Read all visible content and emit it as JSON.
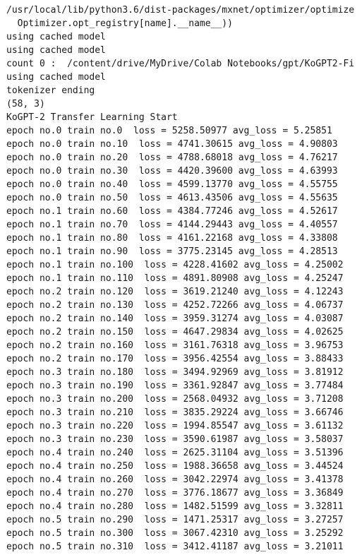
{
  "console": {
    "lines": [
      "/usr/local/lib/python3.6/dist-packages/mxnet/optimizer/optimize",
      "  Optimizer.opt_registry[name].__name__))",
      "using cached model",
      "using cached model",
      "count 0 :  /content/drive/MyDrive/Colab Notebooks/gpt/KoGPT2-Fi",
      "using cached model",
      "tokenizer ending",
      "(58, 3)",
      "KoGPT-2 Transfer Learning Start",
      "epoch no.0 train no.0  loss = 5258.50977 avg_loss = 5.25851",
      "epoch no.0 train no.10  loss = 4741.30615 avg_loss = 4.90803",
      "epoch no.0 train no.20  loss = 4788.68018 avg_loss = 4.76217",
      "epoch no.0 train no.30  loss = 4420.39600 avg_loss = 4.63993",
      "epoch no.0 train no.40  loss = 4599.13770 avg_loss = 4.55755",
      "epoch no.0 train no.50  loss = 4613.43506 avg_loss = 4.55635",
      "epoch no.1 train no.60  loss = 4384.77246 avg_loss = 4.52617",
      "epoch no.1 train no.70  loss = 4144.29443 avg_loss = 4.40557",
      "epoch no.1 train no.80  loss = 4161.22168 avg_loss = 4.33808",
      "epoch no.1 train no.90  loss = 3775.23145 avg_loss = 4.28513",
      "epoch no.1 train no.100  loss = 4228.41602 avg_loss = 4.25002",
      "epoch no.1 train no.110  loss = 4891.80908 avg_loss = 4.25247",
      "epoch no.2 train no.120  loss = 3619.21240 avg_loss = 4.12243",
      "epoch no.2 train no.130  loss = 4252.72266 avg_loss = 4.06737",
      "epoch no.2 train no.140  loss = 3959.31274 avg_loss = 4.03087",
      "epoch no.2 train no.150  loss = 4647.29834 avg_loss = 4.02625",
      "epoch no.2 train no.160  loss = 3161.76318 avg_loss = 3.96753",
      "epoch no.2 train no.170  loss = 3956.42554 avg_loss = 3.88433",
      "epoch no.3 train no.180  loss = 3494.92969 avg_loss = 3.81912",
      "epoch no.3 train no.190  loss = 3361.92847 avg_loss = 3.77484",
      "epoch no.3 train no.200  loss = 2568.04932 avg_loss = 3.71208",
      "epoch no.3 train no.210  loss = 3835.29224 avg_loss = 3.66746",
      "epoch no.3 train no.220  loss = 1994.85547 avg_loss = 3.61132",
      "epoch no.3 train no.230  loss = 3590.61987 avg_loss = 3.58037",
      "epoch no.4 train no.240  loss = 2625.31104 avg_loss = 3.51396",
      "epoch no.4 train no.250  loss = 1988.36658 avg_loss = 3.44524",
      "epoch no.4 train no.260  loss = 3042.22974 avg_loss = 3.41378",
      "epoch no.4 train no.270  loss = 3776.18677 avg_loss = 3.36849",
      "epoch no.4 train no.280  loss = 1482.51599 avg_loss = 3.32811",
      "epoch no.5 train no.290  loss = 1471.25317 avg_loss = 3.27257",
      "epoch no.5 train no.300  loss = 3067.42310 avg_loss = 3.25292",
      "epoch no.5 train no.310  loss = 3412.41187 avg_loss = 3.21011"
    ]
  }
}
